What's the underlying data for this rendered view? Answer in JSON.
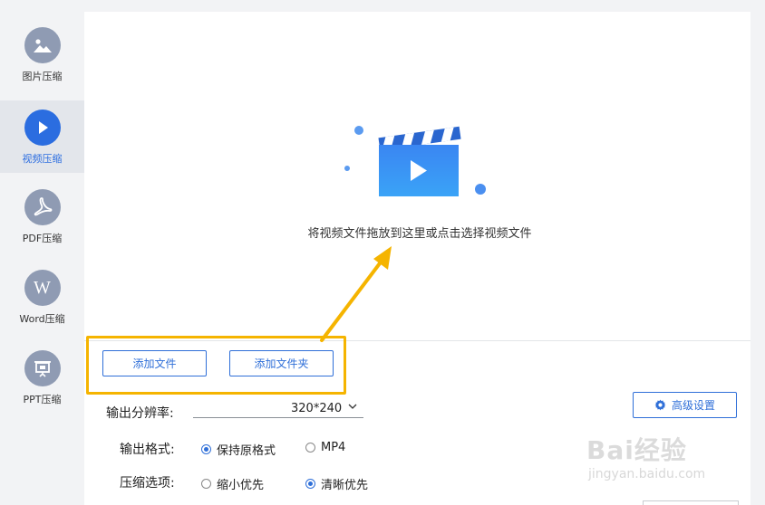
{
  "sidebar": {
    "items": [
      {
        "label": "图片压缩",
        "icon": "image-icon"
      },
      {
        "label": "视频压缩",
        "icon": "play-icon",
        "active": true
      },
      {
        "label": "PDF压缩",
        "icon": "pdf-icon"
      },
      {
        "label": "Word压缩",
        "icon": "word-icon",
        "glyph": "W"
      },
      {
        "label": "PPT压缩",
        "icon": "ppt-icon"
      }
    ]
  },
  "drop_area": {
    "text": "将视频文件拖放到这里或点击选择视频文件",
    "icon": "video-clapper-icon"
  },
  "buttons": {
    "add_file": "添加文件",
    "add_folder": "添加文件夹",
    "advanced": "高级设置"
  },
  "options": {
    "resolution_label": "输出分辨率:",
    "resolution_value": "320*240",
    "format_label": "输出格式:",
    "format_options": [
      {
        "label": "保持原格式",
        "selected": true
      },
      {
        "label": "MP4",
        "selected": false
      }
    ],
    "compress_label": "压缩选项:",
    "compress_options": [
      {
        "label": "缩小优先",
        "selected": false
      },
      {
        "label": "清晰优先",
        "selected": true
      }
    ]
  },
  "watermark": {
    "logo": "Bai经验",
    "url": "jingyan.baidu.com"
  },
  "colors": {
    "accent": "#2f6fd8",
    "sidebar_icon": "#8f9bb3",
    "active_icon": "#2b6de0",
    "annotation": "#f5b400"
  }
}
